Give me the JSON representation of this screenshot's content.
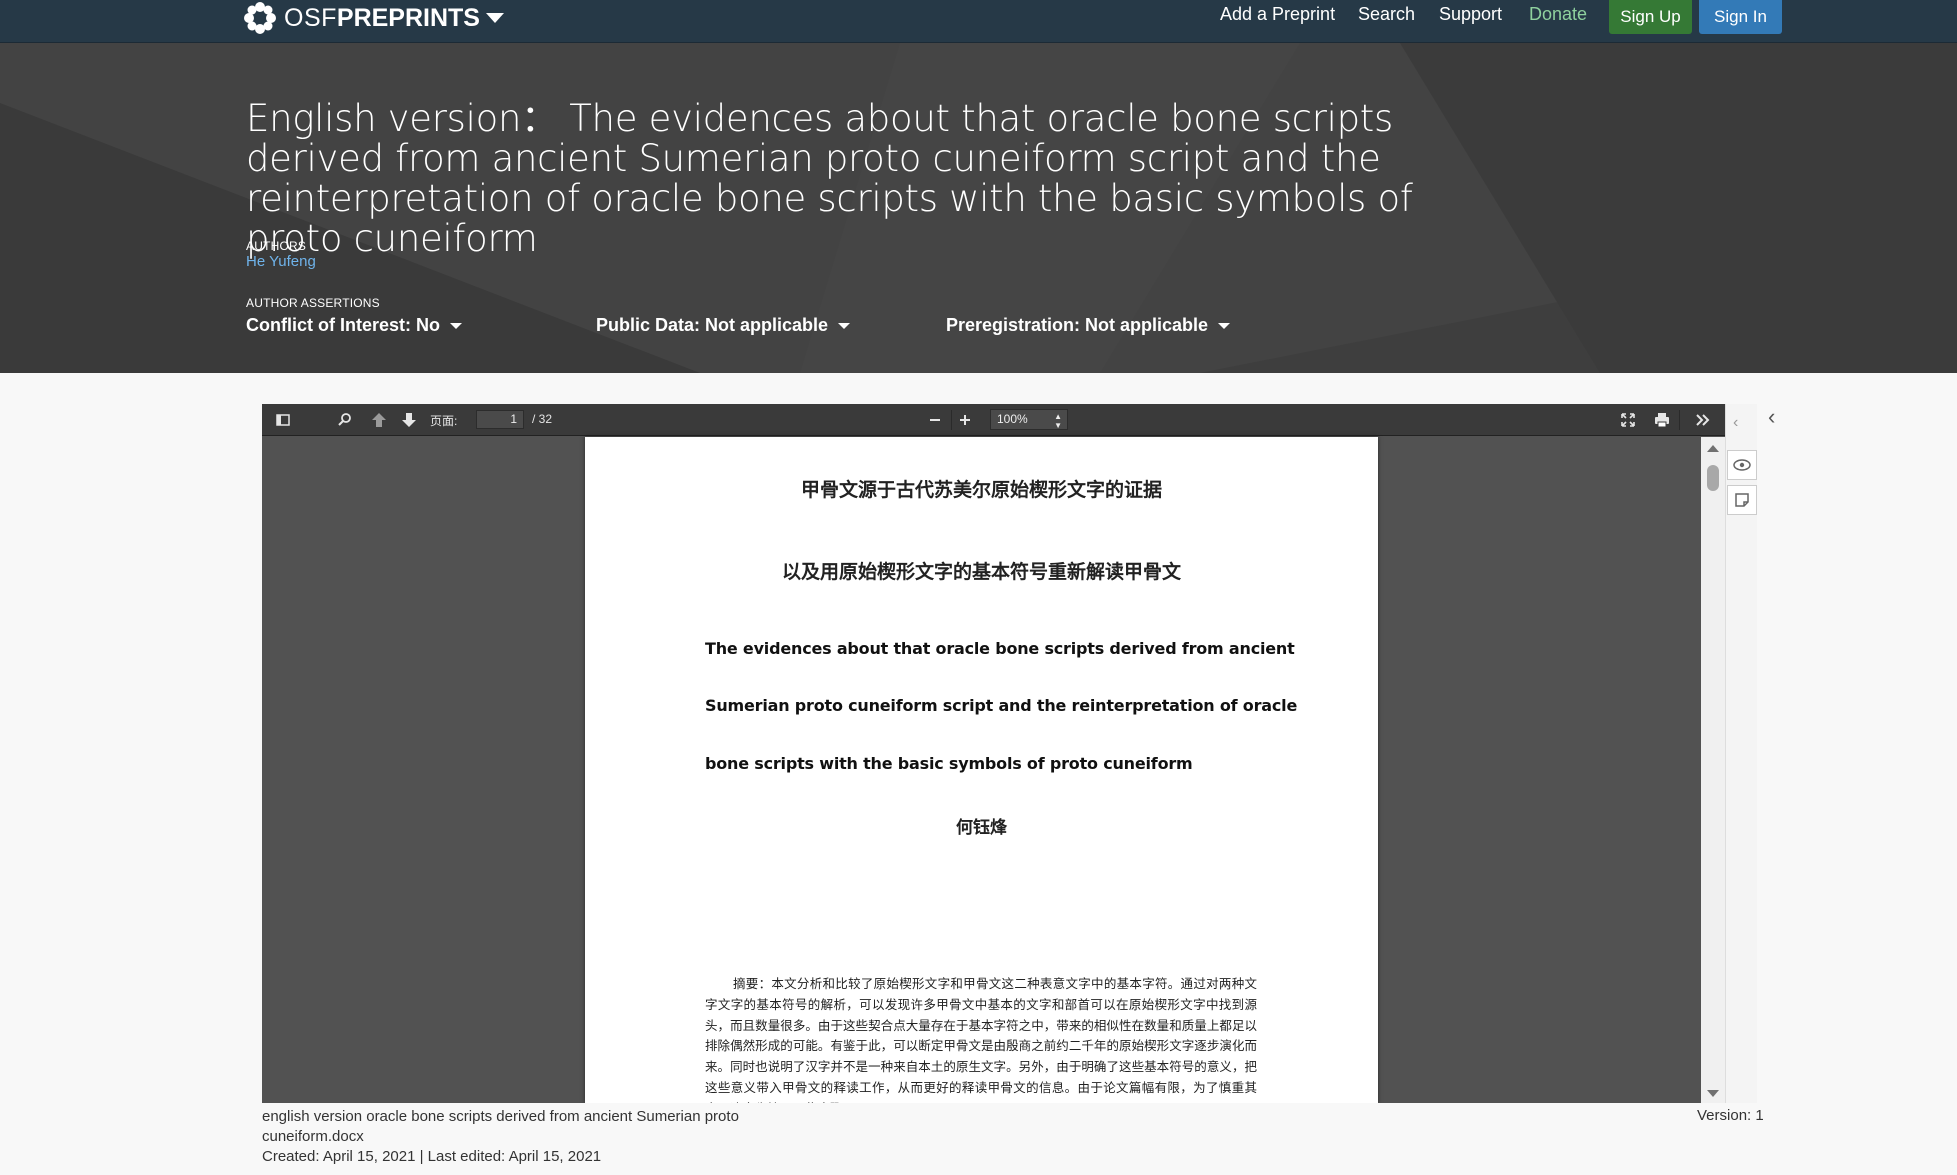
{
  "navbar": {
    "brand_osf": "OSF",
    "brand_preprints": "PREPRINTS",
    "links": {
      "add_preprint": "Add a Preprint",
      "search": "Search",
      "support": "Support",
      "donate": "Donate"
    },
    "sign_up": "Sign Up",
    "sign_in": "Sign In"
  },
  "header": {
    "title": "English version： The evidences about that oracle bone scripts derived from ancient Sumerian proto cuneiform script and the reinterpretation of oracle bone scripts with the basic symbols of proto cuneiform",
    "authors_label": "AUTHORS",
    "author": "He Yufeng",
    "assertions_label": "AUTHOR ASSERTIONS",
    "assertions": {
      "conflict": "Conflict of Interest: No",
      "public_data": "Public Data: Not applicable",
      "preregistration": "Preregistration: Not applicable"
    }
  },
  "viewer": {
    "page_label": "页面:",
    "current_page": "1",
    "page_total": "/ 32",
    "zoom": "100%",
    "icons": [
      "sidebar-toggle-icon",
      "search-icon",
      "previous-page-icon",
      "next-page-icon",
      "zoom-out-icon",
      "zoom-in-icon",
      "fullscreen-icon",
      "print-icon",
      "tools-icon"
    ]
  },
  "document": {
    "cn_title_1": "甲骨文源于古代苏美尔原始楔形文字的证据",
    "cn_title_2": "以及用原始楔形文字的基本符号重新解读甲骨文",
    "en_title_lines": [
      "The evidences about that oracle bone scripts derived from ancient",
      "Sumerian proto cuneiform script and the reinterpretation of oracle",
      "bone scripts with the basic symbols of proto cuneiform"
    ],
    "cn_author": "何钰烽",
    "abstract": "摘要：本文分析和比较了原始楔形文字和甲骨文这二种表意文字中的基本字符。通过对两种文字文字的基本符号的解析，可以发现许多甲骨文中基本的文字和部首可以在原始楔形文字中找到源头，而且数量很多。由于这些契合点大量存在于基本字符之中，带来的相似性在数量和质量上都足以排除偶然形成的可能。有鉴于此，可以断定甲骨文是由殷商之前约二千年的原始楔形文字逐步演化而来。同时也说明了汉字并不是一种来自本土的原生文字。另外，由于明确了这些基本符号的意义，把这些意义带入甲骨文的释读工作，从而更好的释读甲骨文的信息。由于论文篇幅有限，为了慎重其事，决定先摘录一些步骤以"
  },
  "file_info": {
    "name_line_1": "english version oracle bone scripts derived from ancient Sumerian proto",
    "name_line_2": "cuneiform.docx",
    "dates": "Created: April 15, 2021 | Last edited: April 15, 2021",
    "version": "Version: 1"
  }
}
